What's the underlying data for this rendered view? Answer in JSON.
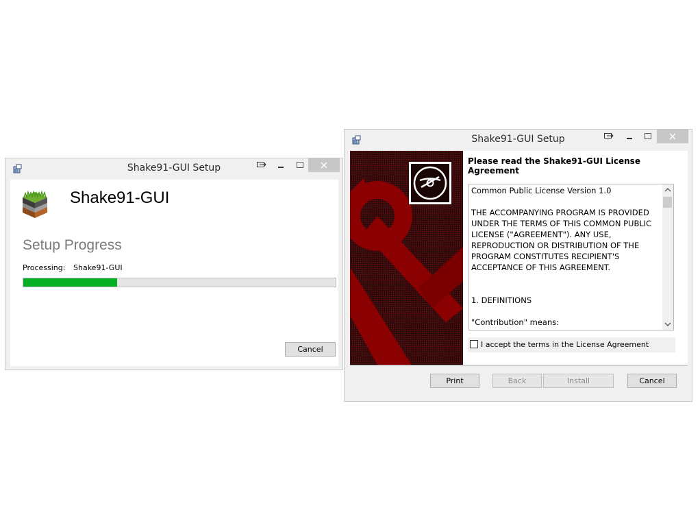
{
  "progress_window": {
    "title": "Shake91-GUI Setup",
    "product_name": "Shake91-GUI",
    "heading": "Setup Progress",
    "processing_label": "Processing:",
    "processing_value": "Shake91-GUI",
    "progress_fraction": 0.3,
    "cancel_label": "Cancel",
    "progress_color": "#06b025"
  },
  "license_window": {
    "title": "Shake91-GUI Setup",
    "heading": "Please read the Shake91-GUI License Agreement",
    "license_text": "Common Public License Version 1.0\n\nTHE ACCOMPANYING PROGRAM IS PROVIDED UNDER THE TERMS OF THIS COMMON PUBLIC LICENSE (\"AGREEMENT\"). ANY USE, REPRODUCTION OR DISTRIBUTION OF THE PROGRAM CONSTITUTES RECIPIENT'S ACCEPTANCE OF THIS AGREEMENT.\n\n\n1. DEFINITIONS\n\n\"Contribution\" means:",
    "accept_label": "I accept the terms in the License Agreement",
    "accept_checked": false,
    "buttons": {
      "print": "Print",
      "back": "Back",
      "install": "Install",
      "cancel": "Cancel"
    },
    "banner_color": "#7a0000"
  },
  "icons": {
    "app_icon": "installer-icon",
    "product_icon": "soil-layers-icon",
    "banner_icon": "disc-icon",
    "caption": [
      "restore-icon",
      "minimize-icon",
      "maximize-icon",
      "close-icon"
    ]
  }
}
